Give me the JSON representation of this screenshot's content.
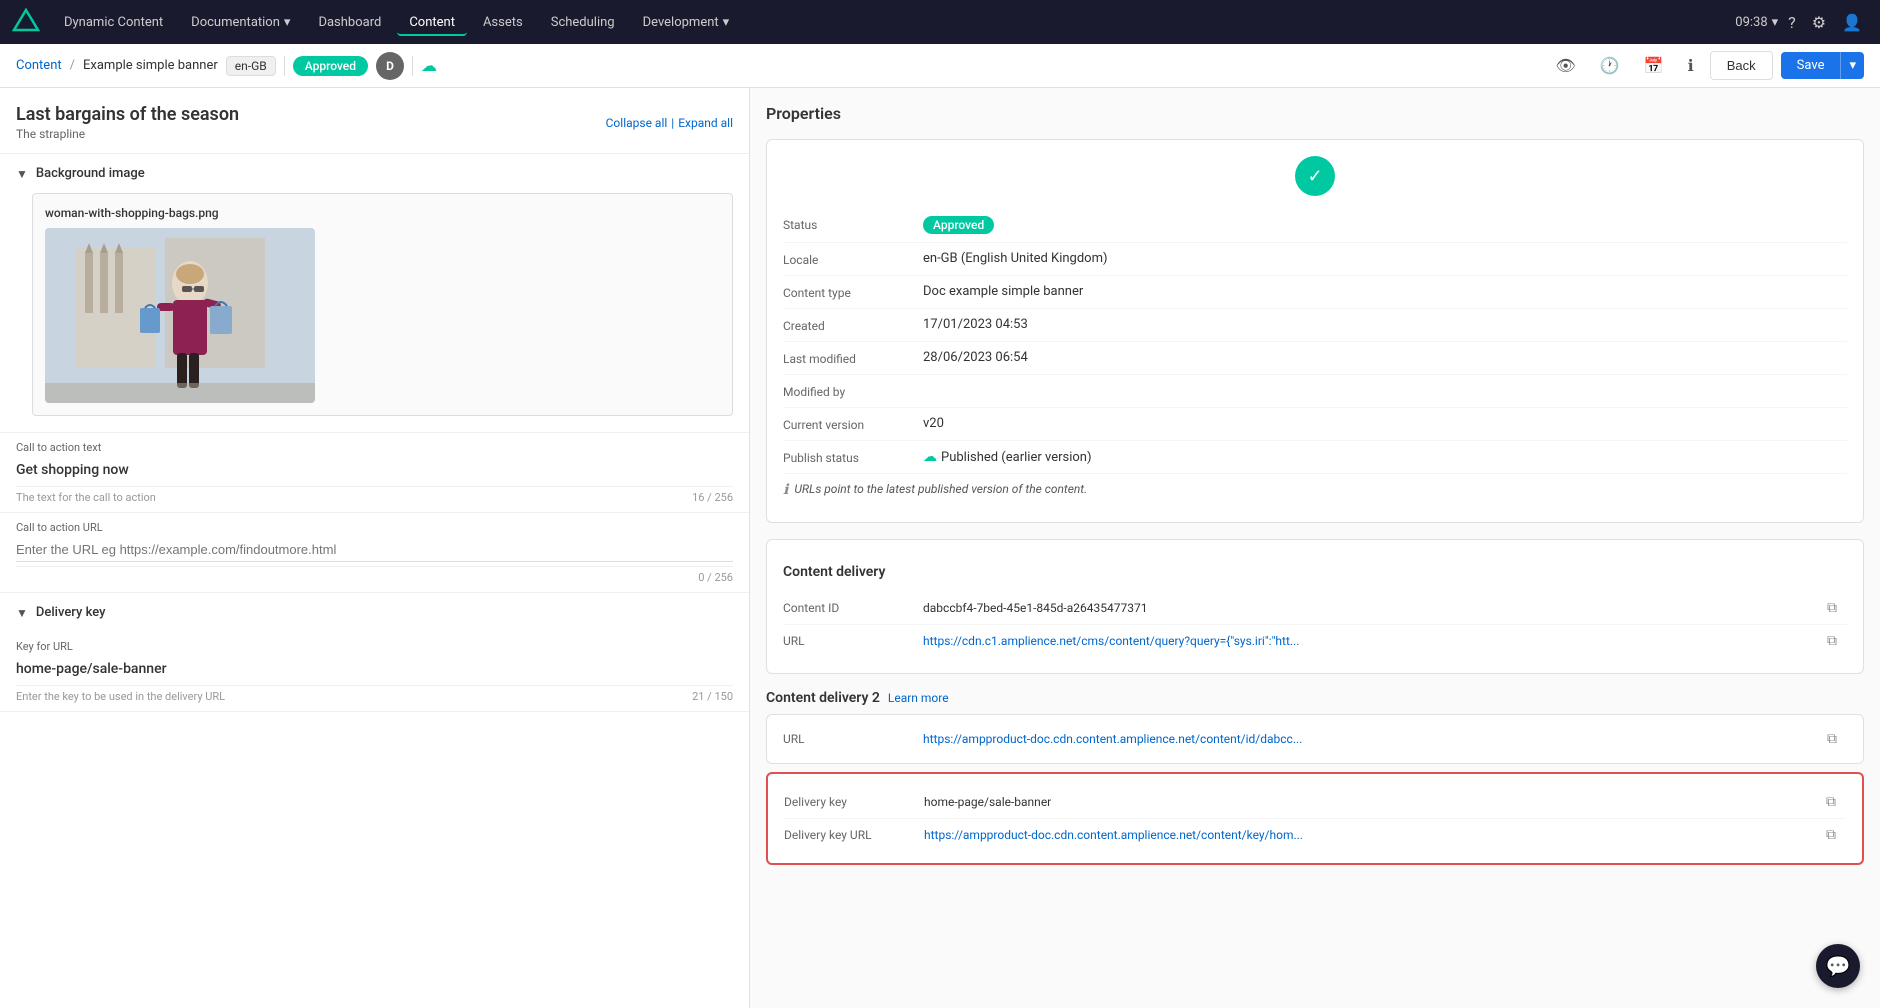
{
  "app": {
    "name": "Dynamic Content",
    "logo_icon": "◆"
  },
  "nav": {
    "items": [
      {
        "label": "Documentation",
        "active": false,
        "has_arrow": true
      },
      {
        "label": "Dashboard",
        "active": false,
        "has_arrow": false
      },
      {
        "label": "Content",
        "active": true,
        "has_arrow": false
      },
      {
        "label": "Assets",
        "active": false,
        "has_arrow": false
      },
      {
        "label": "Scheduling",
        "active": false,
        "has_arrow": false
      },
      {
        "label": "Development",
        "active": false,
        "has_arrow": true
      }
    ],
    "time": "09:38",
    "time_arrow": "▾"
  },
  "breadcrumb": {
    "content_link": "Content",
    "separator": "/",
    "current": "Example simple banner",
    "locale": "en-GB",
    "status": "Approved",
    "avatar": "D",
    "back_label": "Back",
    "save_label": "Save"
  },
  "left_panel": {
    "title": "Last bargains of the season",
    "subtitle": "The strapline",
    "collapse_all": "Collapse all",
    "expand_all": "Expand all",
    "separator": "|",
    "background_section": {
      "label": "Background image",
      "filename": "woman-with-shopping-bags.png"
    },
    "cta_text_section": {
      "label": "Call to action text",
      "value": "Get shopping now",
      "hint": "The text for the call to action",
      "counter": "16 / 256"
    },
    "cta_url_section": {
      "label": "Call to action URL",
      "placeholder": "Enter the URL eg https://example.com/findoutmore.html",
      "counter": "0 / 256"
    },
    "delivery_key_section": {
      "label": "Delivery key",
      "key_label": "Key for URL",
      "key_value": "home-page/sale-banner",
      "key_hint": "Enter the key to be used in the delivery URL",
      "key_counter": "21 / 150"
    }
  },
  "right_panel": {
    "title": "Properties",
    "properties": {
      "status_label": "Status",
      "status_value": "Approved",
      "locale_label": "Locale",
      "locale_value": "en-GB (English United Kingdom)",
      "content_type_label": "Content type",
      "content_type_value": "Doc example simple banner",
      "created_label": "Created",
      "created_value": "17/01/2023 04:53",
      "last_modified_label": "Last modified",
      "last_modified_value": "28/06/2023 06:54",
      "modified_by_label": "Modified by",
      "modified_by_value": "",
      "current_version_label": "Current version",
      "current_version_value": "v20",
      "publish_status_label": "Publish status",
      "publish_status_value": "Published (earlier version)",
      "url_note": "URLs point to the latest published version of the content."
    },
    "content_delivery": {
      "title": "Content delivery",
      "content_id_label": "Content ID",
      "content_id_value": "dabccbf4-7bed-45e1-845d-a26435477371",
      "url_label": "URL",
      "url_value": "https://cdn.c1.amplience.net/cms/content/query?query={\"sys.iri\":\"htt..."
    },
    "content_delivery2": {
      "title": "Content delivery 2",
      "learn_more": "Learn more",
      "url_label": "URL",
      "url_value": "https://ampproduct-doc.cdn.content.amplience.net/content/id/dabcc...",
      "delivery_key_label": "Delivery key",
      "delivery_key_value": "home-page/sale-banner",
      "delivery_key_url_label": "Delivery key URL",
      "delivery_key_url_value": "https://ampproduct-doc.cdn.content.amplience.net/content/key/hom..."
    }
  }
}
